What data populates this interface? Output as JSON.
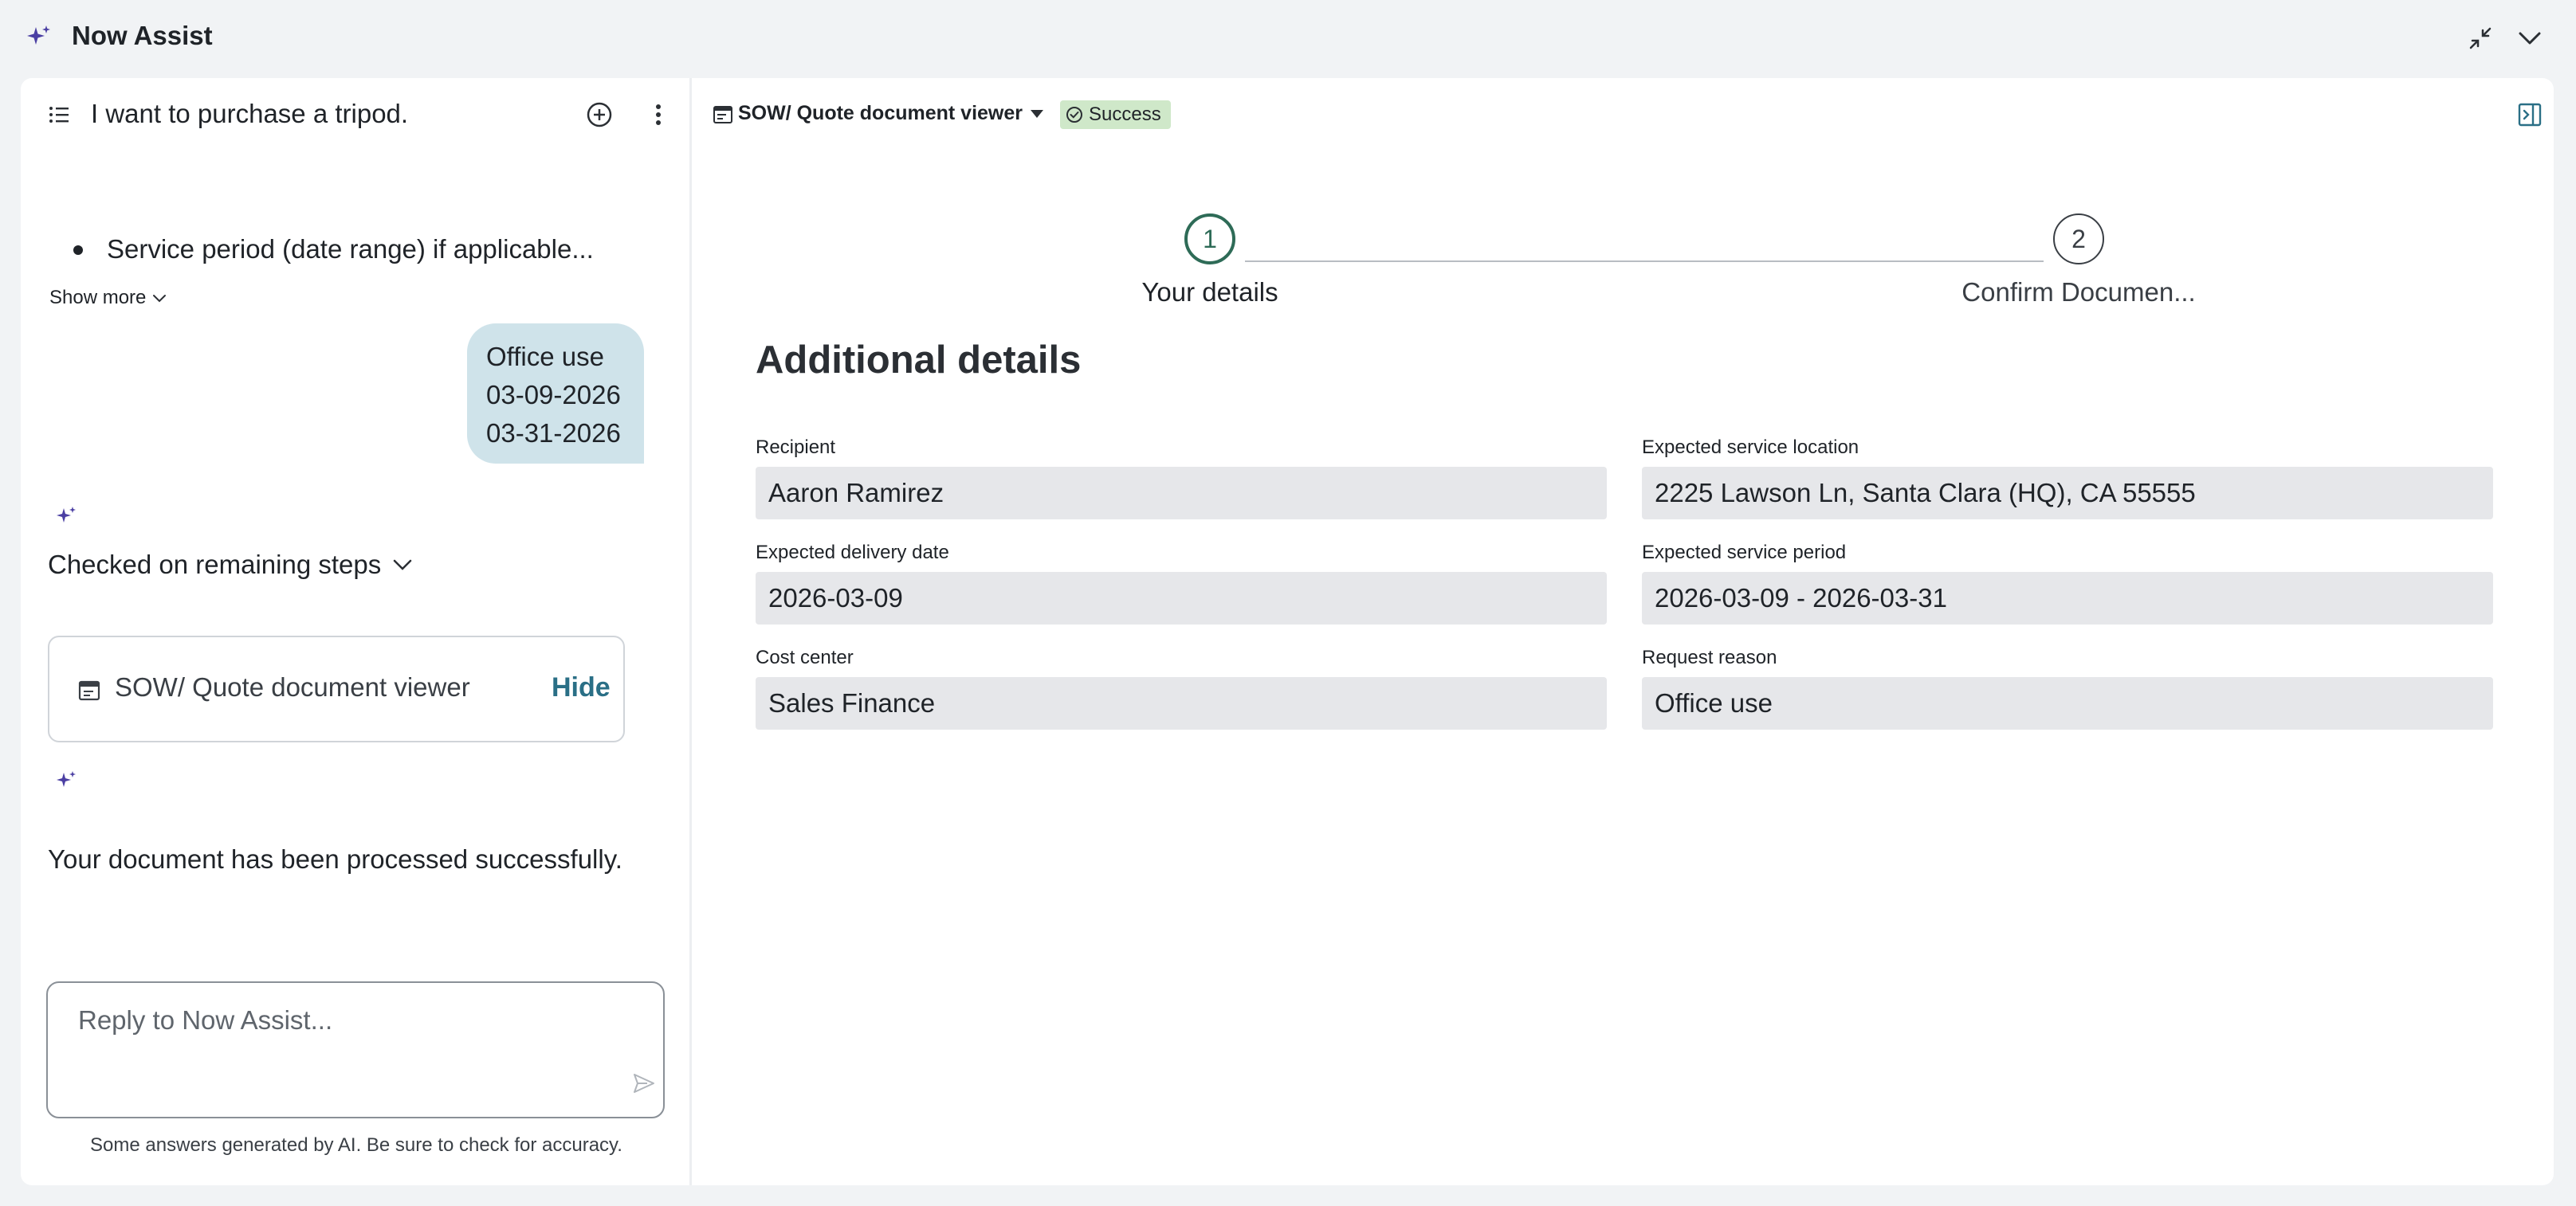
{
  "app": {
    "title": "Now Assist"
  },
  "conversation": {
    "title": "I want to purchase a tripod.",
    "bullet_text": "Service period (date range) if applicable...",
    "show_more_label": "Show more",
    "user_message_lines": [
      "Office use",
      "03-09-2026",
      "03-31-2026"
    ],
    "checked_label": "Checked on remaining steps",
    "doc_card_label": "SOW/ Quote document viewer",
    "doc_card_hide_label": "Hide",
    "processed_message": "Your document has been processed successfully.",
    "reply_placeholder": "Reply to Now Assist...",
    "disclaimer": "Some answers generated by AI. Be sure to check for accuracy."
  },
  "viewer": {
    "title": "SOW/ Quote document viewer",
    "status": "Success",
    "steps": [
      {
        "number": "1",
        "label": "Your details"
      },
      {
        "number": "2",
        "label": "Confirm Documen..."
      }
    ],
    "section_title": "Additional details",
    "fields": {
      "recipient": {
        "label": "Recipient",
        "value": "Aaron Ramirez"
      },
      "service_location": {
        "label": "Expected service location",
        "value": "2225 Lawson Ln, Santa Clara (HQ), CA 55555"
      },
      "delivery_date": {
        "label": "Expected delivery date",
        "value": "2026-03-09"
      },
      "service_period": {
        "label": "Expected service period",
        "value": "2026-03-09 - 2026-03-31"
      },
      "cost_center": {
        "label": "Cost center",
        "value": "Sales Finance"
      },
      "request_reason": {
        "label": "Request reason",
        "value": "Office use"
      }
    }
  },
  "colors": {
    "accent_purple": "#4b3fa3",
    "bubble": "#cfe3ea",
    "success_bg": "#cfe8c9",
    "step_active": "#2e6b57",
    "hide_link": "#2a6f86",
    "field_bg": "#e6e7ea"
  },
  "icons": {
    "app": "sparkle-icon",
    "minimize": "minimize-icon",
    "collapse_chevron": "chevron-down-icon",
    "menu": "list-icon",
    "new_chat": "plus-circle-icon",
    "more": "kebab-icon",
    "document": "document-viewer-icon",
    "status": "check-circle-icon",
    "panel_toggle": "collapse-panel-icon",
    "send": "send-icon"
  }
}
